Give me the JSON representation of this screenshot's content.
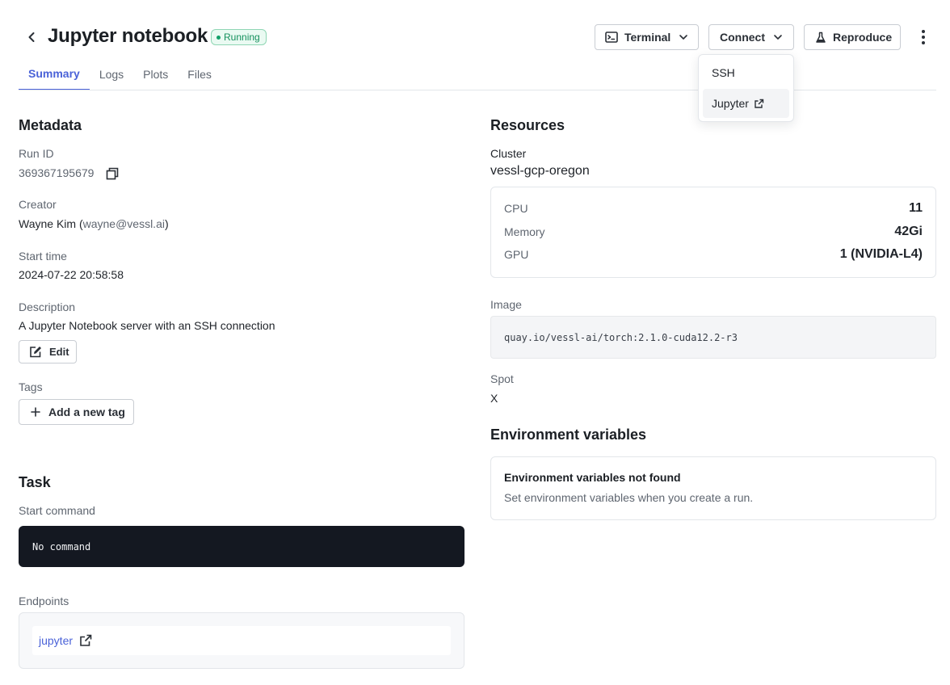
{
  "header": {
    "title": "Jupyter notebook",
    "status": "Running",
    "buttons": {
      "terminal": "Terminal",
      "connect": "Connect",
      "reproduce": "Reproduce"
    }
  },
  "tabs": [
    {
      "label": "Summary",
      "active": true
    },
    {
      "label": "Logs",
      "active": false
    },
    {
      "label": "Plots",
      "active": false
    },
    {
      "label": "Files",
      "active": false
    }
  ],
  "connect_menu": {
    "items": [
      {
        "label": "SSH"
      },
      {
        "label": "Jupyter"
      }
    ]
  },
  "metadata": {
    "section_title": "Metadata",
    "run_id_label": "Run ID",
    "run_id": "369367195679",
    "creator_label": "Creator",
    "creator_name": "Wayne Kim (",
    "creator_email": "wayne@vessl.ai",
    "creator_close": ")",
    "start_time_label": "Start time",
    "start_time": "2024-07-22 20:58:58",
    "description_label": "Description",
    "description": "A Jupyter Notebook server with an SSH connection",
    "edit_label": "Edit",
    "tags_label": "Tags",
    "add_tag_label": "Add a new tag"
  },
  "task": {
    "section_title": "Task",
    "start_command_label": "Start command",
    "start_command": "No command",
    "endpoints_label": "Endpoints",
    "endpoint": "jupyter"
  },
  "resources": {
    "section_title": "Resources",
    "cluster_label": "Cluster",
    "cluster": "vessl-gcp-oregon",
    "rows": [
      {
        "key": "CPU",
        "value": "11"
      },
      {
        "key": "Memory",
        "value": "42Gi"
      },
      {
        "key": "GPU",
        "value": "1 (NVIDIA-L4)"
      }
    ],
    "image_label": "Image",
    "image": "quay.io/vessl-ai/torch:2.1.0-cuda12.2-r3",
    "spot_label": "Spot",
    "spot": "X"
  },
  "env": {
    "section_title": "Environment variables",
    "empty_title": "Environment variables not found",
    "empty_sub": "Set environment variables when you create a run."
  },
  "colors": {
    "accent": "#4a62d8",
    "status_green": "#14905c",
    "code_bg": "#141821"
  },
  "icons": [
    "chevron-left-icon",
    "terminal-icon",
    "chevron-down-icon",
    "flask-icon",
    "kebab-menu-icon",
    "copy-icon",
    "edit-icon",
    "plus-icon",
    "external-link-icon"
  ]
}
